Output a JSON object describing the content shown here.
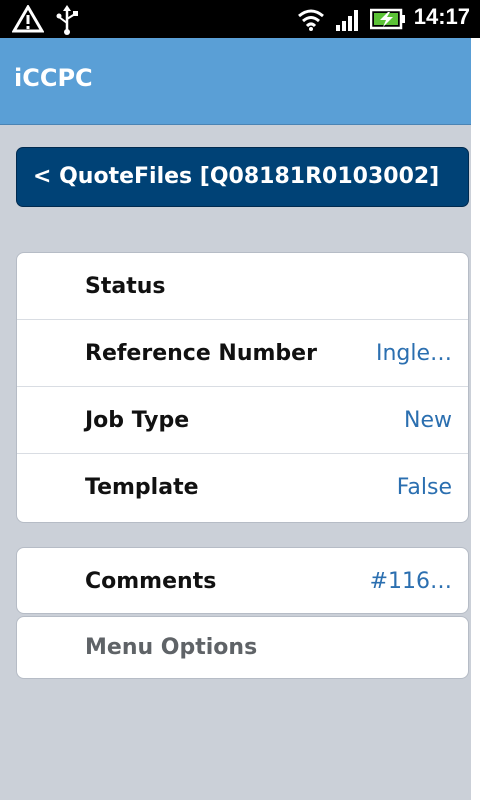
{
  "status_bar": {
    "time": "14:17",
    "icons": [
      "warning-icon",
      "usb-icon",
      "wifi-icon",
      "signal-icon",
      "battery-charging-icon"
    ]
  },
  "app": {
    "title": "iCCPC"
  },
  "back_button": {
    "label": "< QuoteFiles [Q08181R0103002]"
  },
  "details": [
    {
      "label": "Status",
      "value": ""
    },
    {
      "label": "Reference Number",
      "value": "Ingle…"
    },
    {
      "label": "Job Type",
      "value": "New"
    },
    {
      "label": "Template",
      "value": "False"
    }
  ],
  "comments": {
    "label": "Comments",
    "value": "#116…"
  },
  "menu_options": {
    "label": "Menu Options"
  },
  "colors": {
    "appbar": "#5a9fd6",
    "back_button": "#004276",
    "value_text": "#2b6fb0",
    "background": "#cbd0d8"
  }
}
